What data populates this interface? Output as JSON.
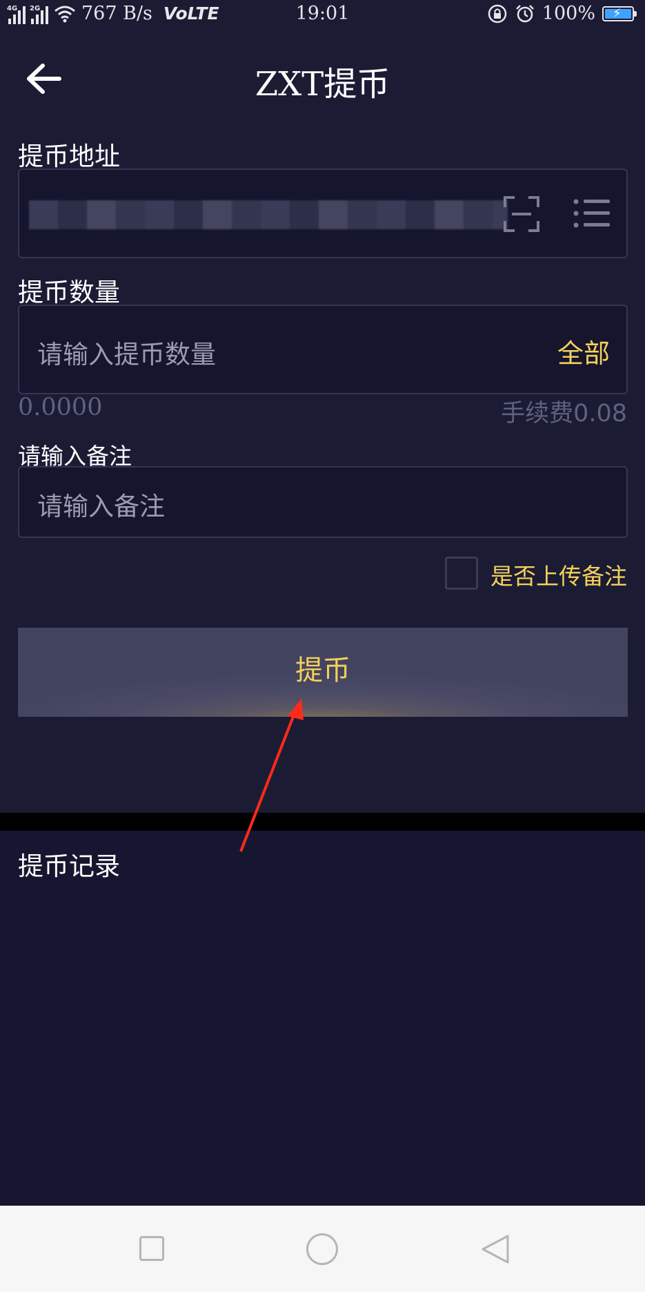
{
  "status_bar": {
    "net_4g": "4G",
    "net_2g": "2G",
    "speed": "767 B/s",
    "volte": "VoLTE",
    "time": "19:01",
    "battery": "100%"
  },
  "nav": {
    "title": "ZXT提币"
  },
  "address": {
    "label": "提币地址"
  },
  "amount": {
    "label": "提币数量",
    "placeholder": "请输入提币数量",
    "all_label": "全部",
    "available": "0.0000",
    "fee": "手续费0.08"
  },
  "memo": {
    "label": "请输入备注",
    "placeholder": "请输入备注",
    "upload_label": "是否上传备注"
  },
  "submit_label": "提币",
  "records": {
    "title": "提币记录"
  },
  "colors": {
    "accent": "#f5d15a",
    "background": "#1b1b34",
    "annotation_arrow": "#ff2a1a"
  }
}
